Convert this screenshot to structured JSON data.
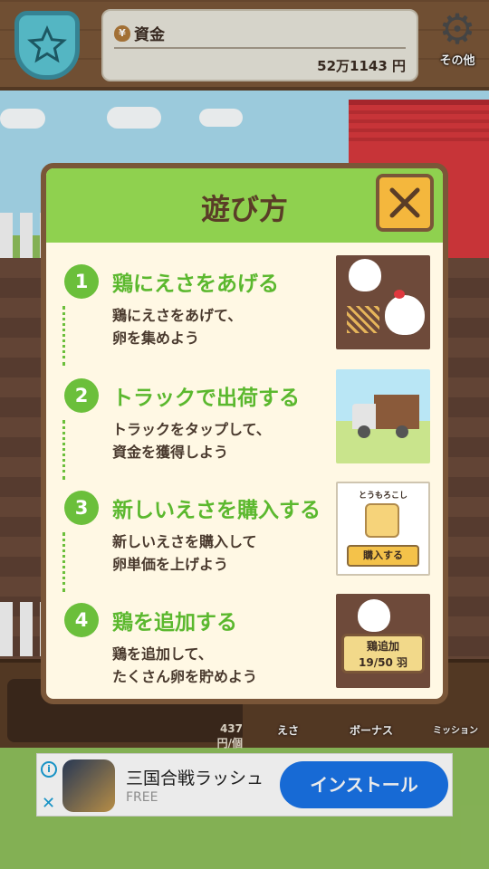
{
  "header": {
    "fund_label": "資金",
    "fund_value": "52万1143 円",
    "other_label": "その他"
  },
  "dialog": {
    "title": "遊び方",
    "steps": [
      {
        "num": "1",
        "title": "鶏にえさをあげる",
        "desc": "鶏にえさをあげて、\n卵を集めよう"
      },
      {
        "num": "2",
        "title": "トラックで出荷する",
        "desc": "トラックをタップして、\n資金を獲得しよう"
      },
      {
        "num": "3",
        "title": "新しいえさを購入する",
        "desc": "新しいえさを購入して\n卵単価を上げよう"
      },
      {
        "num": "4",
        "title": "鶏を追加する",
        "desc": "鶏を追加して、\nたくさん卵を貯めよう"
      }
    ],
    "feed_name": "とうもろこし",
    "buy_label": "購入する",
    "add_label": "鶏追加",
    "add_count": "19/50 羽"
  },
  "bottom": {
    "price_value": "437",
    "price_unit": "円/個",
    "feed_btn": "えさ",
    "bonus_btn": "ボーナス",
    "mission_btn": "ミッション"
  },
  "ad": {
    "app_name": "三国合戦ラッシュ",
    "price": "FREE",
    "install_label": "インストール"
  },
  "colors": {
    "accent_green": "#6bbf3b",
    "header_green": "#8fd14f",
    "wood": "#7a5638",
    "install_blue": "#1a73e8"
  }
}
